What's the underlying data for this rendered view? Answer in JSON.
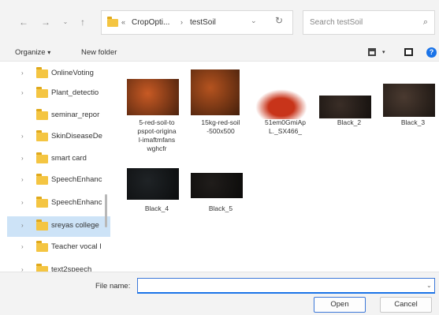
{
  "address_bar": {
    "path_overflow": "«",
    "folder1": "CropOpti...",
    "sep": "›",
    "folder2": "testSoil",
    "dropdown_icon": "chevron-down-icon",
    "refresh_icon": "refresh-icon"
  },
  "search": {
    "placeholder": "Search testSoil",
    "icon": "search-icon"
  },
  "nav_icons": [
    "back-arrow-icon",
    "forward-arrow-icon",
    "recent-dropdown-icon",
    "up-arrow-icon"
  ],
  "toolbar": {
    "organize_label": "Organize",
    "organize_arrow": "▾",
    "new_folder_label": "New folder",
    "help_label": "?"
  },
  "sidebar": {
    "items": [
      {
        "label": "OnlineVoting",
        "expandable": true
      },
      {
        "label": "Plant_detectio",
        "expandable": true
      },
      {
        "label": "seminar_repor",
        "expandable": false
      },
      {
        "label": "SkinDiseaseDe",
        "expandable": true
      },
      {
        "label": "smart card",
        "expandable": true
      },
      {
        "label": "SpeechEnhanc",
        "expandable": true
      },
      {
        "label": "SpeechEnhanc",
        "expandable": true
      },
      {
        "label": "sreyas college",
        "expandable": true,
        "selected": true
      },
      {
        "label": "Teacher vocal I",
        "expandable": true
      },
      {
        "label": "text2speech",
        "expandable": true
      }
    ]
  },
  "files": [
    {
      "name": "5-red-soil-topspot-original-imaftmfanswghcfr",
      "lines": [
        "5-red-soil-to",
        "pspot-origina",
        "l-imaftmfans",
        "wghcfr"
      ],
      "color": "#c85a24"
    },
    {
      "name": "15kg-red-soil-500x500",
      "lines": [
        "15kg-red-soil",
        "-500x500"
      ],
      "color": "#b5531f"
    },
    {
      "name": "51em0GmiApL._SX466_",
      "lines": [
        "51em0GmiAp",
        "L._SX466_"
      ],
      "color": "#b52a12"
    },
    {
      "name": "Black_2",
      "lines": [
        "Black_2"
      ],
      "color": "#3a2e27"
    },
    {
      "name": "Black_3",
      "lines": [
        "Black_3"
      ],
      "color": "#4a3a30"
    },
    {
      "name": "Black_4",
      "lines": [
        "Black_4"
      ],
      "color": "#1f2326"
    },
    {
      "name": "Black_5",
      "lines": [
        "Black_5"
      ],
      "color": "#201d1b"
    }
  ],
  "footer": {
    "file_name_label": "File name:",
    "file_name_value": "",
    "open_label": "Open",
    "cancel_label": "Cancel"
  }
}
